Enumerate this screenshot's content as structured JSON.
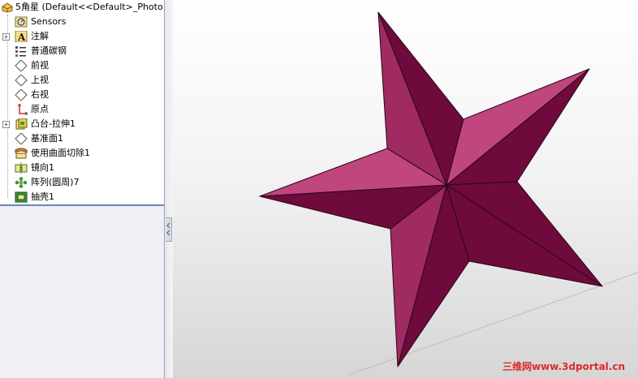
{
  "feature_tree": {
    "root_label": "5角星  (Default<<Default>_Photo",
    "items": [
      {
        "label": "Sensors",
        "icon": "sensors-icon",
        "expandable": false
      },
      {
        "label": "注解",
        "icon": "annotations-icon",
        "expandable": true
      },
      {
        "label": "普通碳钢",
        "icon": "material-icon",
        "expandable": false
      },
      {
        "label": "前视",
        "icon": "plane-icon",
        "expandable": false
      },
      {
        "label": "上视",
        "icon": "plane-icon",
        "expandable": false
      },
      {
        "label": "右视",
        "icon": "plane-icon",
        "expandable": false
      },
      {
        "label": "原点",
        "icon": "origin-icon",
        "expandable": false
      },
      {
        "label": "凸台-拉伸1",
        "icon": "boss-extrude-icon",
        "expandable": true
      },
      {
        "label": "基准面1",
        "icon": "plane-icon",
        "expandable": false
      },
      {
        "label": "使用曲面切除1",
        "icon": "surface-cut-icon",
        "expandable": false
      },
      {
        "label": "镜向1",
        "icon": "mirror-icon",
        "expandable": false
      },
      {
        "label": "阵列(圆周)7",
        "icon": "circular-pattern-icon",
        "expandable": false
      },
      {
        "label": "抽壳1",
        "icon": "shell-icon",
        "expandable": false
      }
    ],
    "expand_symbol": "+"
  },
  "viewport": {
    "model": "5-point star",
    "colors": {
      "light": "#c0467f",
      "mid": "#a02a62",
      "dark": "#6e0a3c",
      "edge": "#2a0718"
    }
  },
  "watermark": {
    "text": "三维网www.3dportal.cn",
    "color": "#e0282a"
  }
}
